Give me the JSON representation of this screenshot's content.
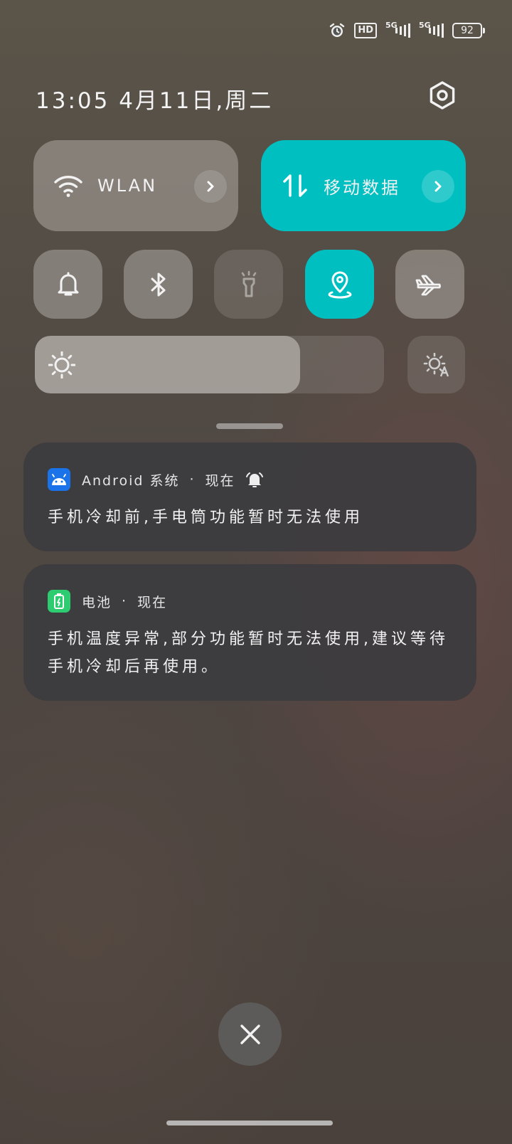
{
  "status_bar": {
    "icons": [
      "alarm-icon",
      "hd-icon",
      "signal-5g-icon",
      "signal-5g-data-icon",
      "battery-icon"
    ],
    "hd_label": "HD",
    "net1_label": "5G",
    "net2_label": "5G",
    "battery_level": "92"
  },
  "header": {
    "datetime": "13:05 4月11日,周二",
    "settings_icon": "settings-hexagon-icon"
  },
  "toggles": {
    "wlan": {
      "label": "WLAN",
      "icon": "wifi-icon",
      "active": false
    },
    "mobile_data": {
      "label": "移动数据",
      "icon": "data-arrows-icon",
      "active": true
    },
    "small": [
      {
        "name": "ring-mode",
        "icon": "bell-icon",
        "active": false
      },
      {
        "name": "bluetooth",
        "icon": "bluetooth-icon",
        "active": false
      },
      {
        "name": "flashlight",
        "icon": "flashlight-icon",
        "active": false,
        "disabled": true
      },
      {
        "name": "location",
        "icon": "location-icon",
        "active": true
      },
      {
        "name": "airplane-mode",
        "icon": "airplane-icon",
        "active": false
      }
    ]
  },
  "brightness": {
    "level": 0.76,
    "auto_icon": "auto-brightness-icon"
  },
  "notifications": [
    {
      "app": "Android 系统",
      "separator": "·",
      "time": "现在",
      "icon": "android-icon",
      "extra_icon": "alarm-bell-icon",
      "text": "手机冷却前,手电筒功能暂时无法使用"
    },
    {
      "app": "电池",
      "separator": "·",
      "time": "现在",
      "icon": "battery-charge-icon",
      "text": "手机温度异常,部分功能暂时无法使用,建议等待手机冷却后再使用。"
    }
  ],
  "colors": {
    "accent": "#00bfc1",
    "android_blue": "#1a73e8",
    "battery_green": "#2ecc71"
  }
}
